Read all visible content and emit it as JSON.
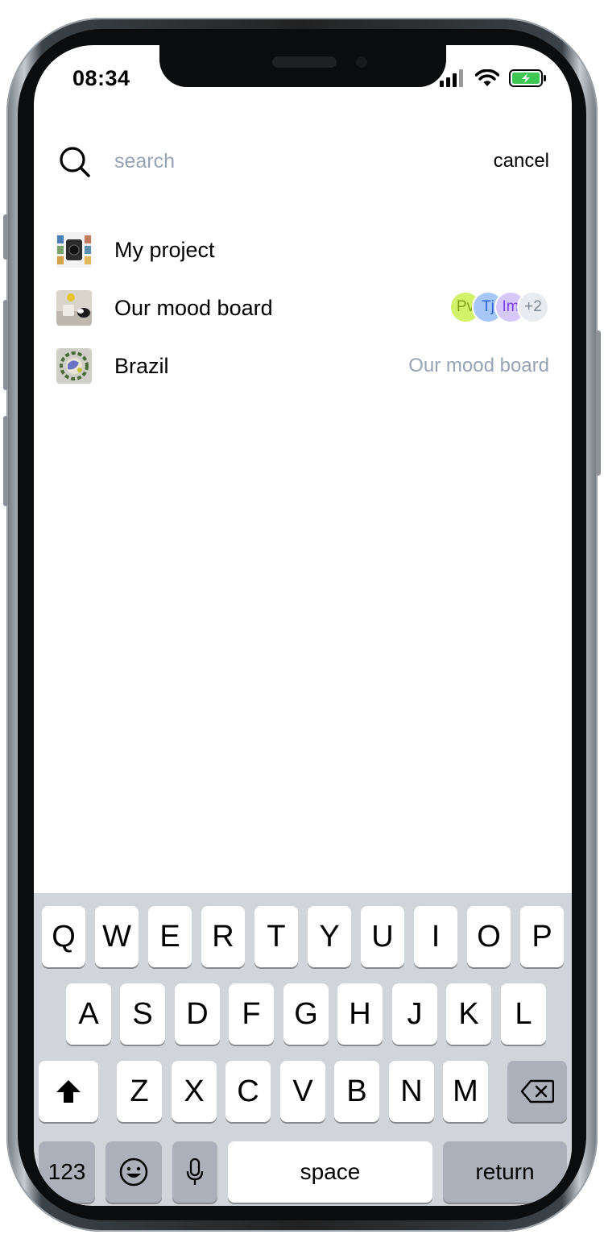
{
  "status_bar": {
    "time": "08:34"
  },
  "search": {
    "placeholder": "search",
    "value": "",
    "cancel_label": "cancel"
  },
  "results": [
    {
      "label": "My project"
    },
    {
      "label": "Our mood board",
      "collaborators": [
        {
          "initials": "Pv",
          "bg": "#d2f26a",
          "fg": "#7ea316"
        },
        {
          "initials": "Tj",
          "bg": "#a7c7f7",
          "fg": "#2c62d8"
        },
        {
          "initials": "Im",
          "bg": "#d6c8fb",
          "fg": "#7a3ff0"
        },
        {
          "initials": "+2",
          "bg": "#e8ebef",
          "fg": "#7b8794"
        }
      ]
    },
    {
      "label": "Brazil",
      "parent": "Our mood board"
    }
  ],
  "keyboard": {
    "row1": [
      "Q",
      "W",
      "E",
      "R",
      "T",
      "Y",
      "U",
      "I",
      "O",
      "P"
    ],
    "row2": [
      "A",
      "S",
      "D",
      "F",
      "G",
      "H",
      "J",
      "K",
      "L"
    ],
    "row3": [
      "Z",
      "X",
      "C",
      "V",
      "B",
      "N",
      "M"
    ],
    "numbers_label": "123",
    "space_label": "space",
    "return_label": "return"
  },
  "colors": {
    "placeholder": "#98a4b3",
    "keyboard_bg": "#d1d4d9",
    "battery": "#3ec752"
  }
}
